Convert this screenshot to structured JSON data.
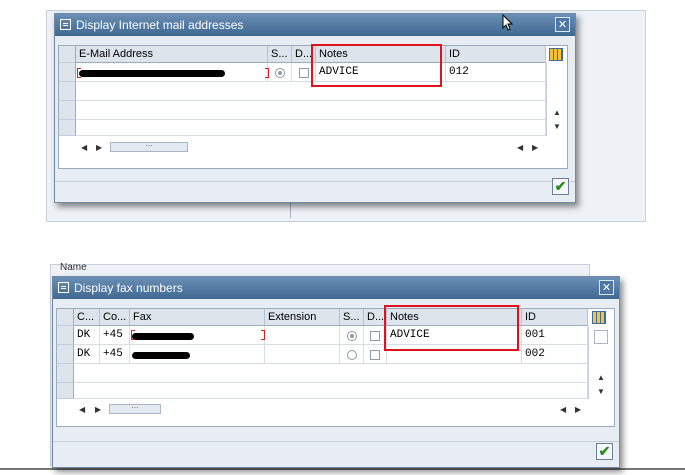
{
  "dialog1": {
    "title": "Display Internet mail addresses",
    "columns": [
      "E-Mail Address",
      "S...",
      "D...",
      "Notes",
      "ID"
    ],
    "rows": [
      {
        "notes": "ADVICE",
        "id": "012",
        "standard": true,
        "do_not_use": false
      }
    ]
  },
  "dialog2": {
    "title": "Display fax numbers",
    "columns": [
      "C...",
      "Co...",
      "Fax",
      "Extension",
      "S...",
      "D...",
      "Notes",
      "ID"
    ],
    "rows": [
      {
        "country": "DK",
        "code": "+45",
        "notes": "ADVICE",
        "id": "001",
        "standard": true,
        "do_not_use": false
      },
      {
        "country": "DK",
        "code": "+45",
        "notes": "",
        "id": "002",
        "standard": false,
        "do_not_use": false
      }
    ]
  },
  "background": {
    "label": "Name"
  },
  "icons": {
    "close": "close-icon",
    "confirm": "checkmark-icon",
    "config": "table-settings-icon"
  },
  "colors": {
    "title_bar": "#4a7199",
    "highlight": "#e0121f",
    "confirm": "#2e8b1f"
  }
}
